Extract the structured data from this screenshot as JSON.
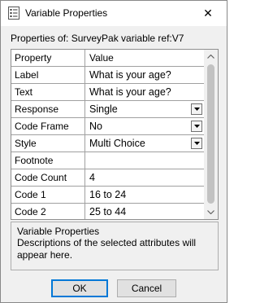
{
  "window": {
    "title": "Variable Properties",
    "close_symbol": "✕"
  },
  "header": {
    "properties_of": "Properties of: SurveyPak variable ref:V7"
  },
  "grid": {
    "columns": [
      "Property",
      "Value"
    ],
    "rows": [
      {
        "property": "Label",
        "value": "What is your age?",
        "dropdown": false
      },
      {
        "property": "Text",
        "value": "What is your age?",
        "dropdown": false
      },
      {
        "property": "Response",
        "value": "Single",
        "dropdown": true
      },
      {
        "property": "Code Frame",
        "value": "No",
        "dropdown": true
      },
      {
        "property": "Style",
        "value": "Multi Choice",
        "dropdown": true
      },
      {
        "property": "Footnote",
        "value": "",
        "dropdown": false
      },
      {
        "property": "Code Count",
        "value": "4",
        "dropdown": false
      },
      {
        "property": "Code 1",
        "value": "16 to 24",
        "dropdown": false
      },
      {
        "property": "Code 2",
        "value": "25 to 44",
        "dropdown": false
      }
    ]
  },
  "description": {
    "title": "Variable Properties",
    "text": "Descriptions of the selected attributes will appear here."
  },
  "buttons": {
    "ok": "OK",
    "cancel": "Cancel"
  },
  "icons": {
    "app": "properties-icon",
    "close": "close-icon",
    "dropdown": "chevron-down-icon"
  }
}
